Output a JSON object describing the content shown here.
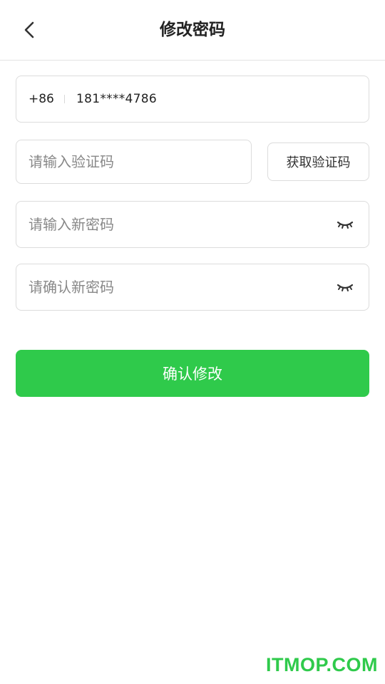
{
  "header": {
    "title": "修改密码",
    "back_icon": "chevron-left-icon"
  },
  "phone": {
    "prefix": "+86",
    "value": "181****4786"
  },
  "code": {
    "placeholder": "请输入验证码",
    "button_label": "获取验证码"
  },
  "new_password": {
    "placeholder": "请输入新密码",
    "toggle_icon": "eye-closed-icon"
  },
  "confirm_password": {
    "placeholder": "请确认新密码",
    "toggle_icon": "eye-closed-icon"
  },
  "submit": {
    "label": "确认修改"
  },
  "watermark": {
    "text": "ITMOP.COM"
  },
  "colors": {
    "accent": "#2fca4b",
    "border": "#dcdcdc",
    "placeholder": "#888888"
  }
}
